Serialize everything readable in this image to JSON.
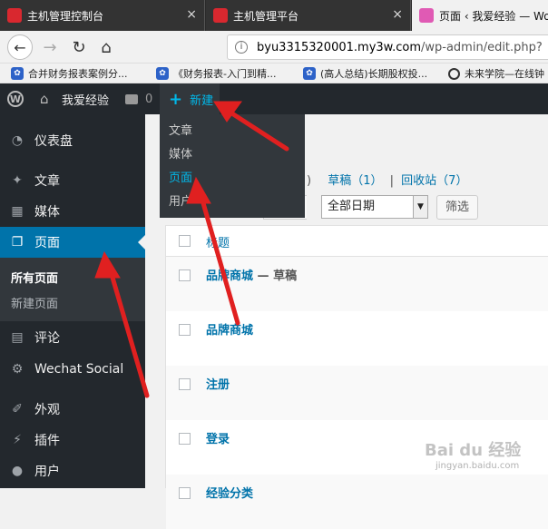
{
  "browser": {
    "tabs": [
      {
        "title": "主机管理控制台",
        "close": "×"
      },
      {
        "title": "主机管理平台",
        "close": "×"
      },
      {
        "title": "页面 ‹ 我爱经验 — Wo"
      }
    ],
    "url": {
      "host": "byu3315320001.my3w.com",
      "path": "/wp-admin/edit.php?"
    },
    "bookmarks": [
      "合并财务报表案例分...",
      "《财务报表-入门到精...",
      "(高人总结)长期股权投...",
      "未来学院—在线钟"
    ]
  },
  "adminbar": {
    "site_name": "我爱经验",
    "comment_count": "0",
    "new_label": "新建",
    "plus": "+"
  },
  "new_menu": [
    "文章",
    "媒体",
    "页面",
    "用户"
  ],
  "sidebar": {
    "items": [
      {
        "label": "仪表盘"
      },
      {
        "label": "文章"
      },
      {
        "label": "媒体"
      },
      {
        "label": "页面"
      },
      {
        "label": "评论"
      },
      {
        "label": "Wechat Social"
      },
      {
        "label": "外观"
      },
      {
        "label": "插件"
      },
      {
        "label": "用户"
      }
    ],
    "submenu": [
      "所有页面",
      "新建页面"
    ]
  },
  "main": {
    "filter_partial": ")",
    "filter_drafts": "草稿（1）",
    "filter_sep": "|",
    "filter_trash": "回收站（7）",
    "date_select": "全部日期",
    "filter_button": "筛选",
    "col_title": "标题",
    "rows": [
      {
        "title": "品牌商城",
        "state": " — 草稿"
      },
      {
        "title": "品牌商城",
        "state": ""
      },
      {
        "title": "注册",
        "state": ""
      },
      {
        "title": "登录",
        "state": ""
      },
      {
        "title": "经验分类",
        "state": ""
      }
    ]
  },
  "watermark": {
    "text": "Bai du 经验",
    "sub": "jingyan.baidu.com"
  },
  "colors": {
    "accent": "#0073aa",
    "adminbar": "#23282d",
    "arrow": "#e02020"
  }
}
